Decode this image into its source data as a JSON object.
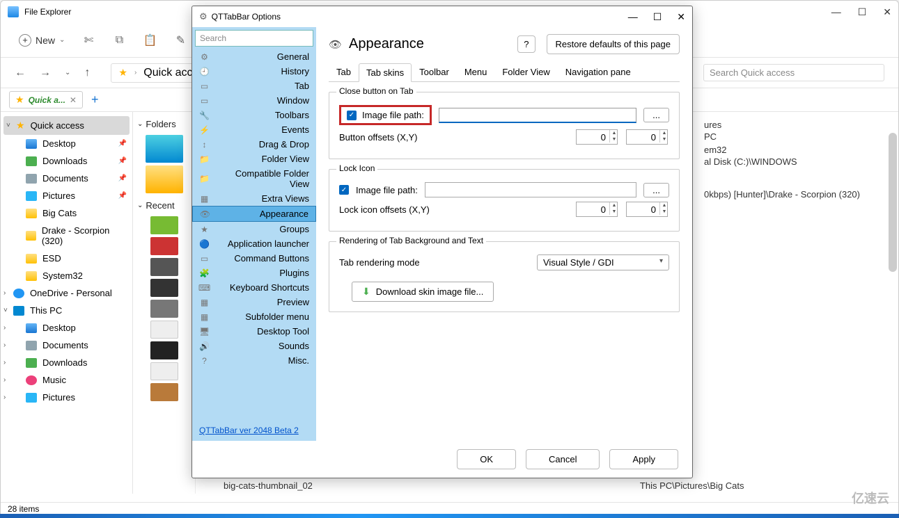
{
  "explorer": {
    "title": "File Explorer",
    "new_label": "New",
    "nav_path": "Quick access",
    "search_placeholder": "Search Quick access",
    "tab_label": "Quick a...",
    "status": "28 items",
    "sidebar": [
      {
        "label": "Quick access",
        "icon": "star",
        "selected": true,
        "caret": "˅"
      },
      {
        "label": "Desktop",
        "icon": "blue",
        "pin": true,
        "indent": true
      },
      {
        "label": "Downloads",
        "icon": "green",
        "pin": true,
        "indent": true
      },
      {
        "label": "Documents",
        "icon": "doc",
        "pin": true,
        "indent": true
      },
      {
        "label": "Pictures",
        "icon": "pic",
        "pin": true,
        "indent": true
      },
      {
        "label": "Big Cats",
        "icon": "folder",
        "indent": true
      },
      {
        "label": "Drake - Scorpion (320)",
        "icon": "folder",
        "indent": true
      },
      {
        "label": "ESD",
        "icon": "folder",
        "indent": true
      },
      {
        "label": "System32",
        "icon": "folder",
        "indent": true
      },
      {
        "label": "OneDrive - Personal",
        "icon": "cloud",
        "caret": "›"
      },
      {
        "label": "This PC",
        "icon": "pc",
        "caret": "˅"
      },
      {
        "label": "Desktop",
        "icon": "blue",
        "indent": true,
        "caret": "›"
      },
      {
        "label": "Documents",
        "icon": "doc",
        "indent": true,
        "caret": "›"
      },
      {
        "label": "Downloads",
        "icon": "green",
        "indent": true,
        "caret": "›"
      },
      {
        "label": "Music",
        "icon": "music",
        "indent": true,
        "caret": "›"
      },
      {
        "label": "Pictures",
        "icon": "pic",
        "indent": true,
        "caret": "›"
      }
    ],
    "middle": {
      "folders_label": "Folders",
      "recent_label": "Recent"
    },
    "right_lines": [
      "ures",
      "PC",
      "",
      "em32",
      "al Disk (C:)\\WINDOWS",
      "",
      "",
      "",
      "",
      "",
      "",
      "",
      "",
      "",
      "",
      "",
      "",
      "",
      "",
      "",
      "0kbps) [Hunter]\\Drake - Scorpion (320)"
    ],
    "file_row_name": "big-cats-thumbnail_02",
    "file_row_loc": "This PC\\Pictures\\Big Cats"
  },
  "dialog": {
    "title": "QTTabBar Options",
    "search_placeholder": "Search",
    "header": "Appearance",
    "help_tooltip": "?",
    "restore_label": "Restore defaults of this page",
    "version": "QTTabBar ver 2048 Beta 2",
    "categories": [
      "General",
      "History",
      "Tab",
      "Window",
      "Toolbars",
      "Events",
      "Drag & Drop",
      "Folder View",
      "Compatible Folder View",
      "Extra Views",
      "Appearance",
      "Groups",
      "Application launcher",
      "Command Buttons",
      "Plugins",
      "Keyboard Shortcuts",
      "Preview",
      "Subfolder menu",
      "Desktop Tool",
      "Sounds",
      "Misc."
    ],
    "category_selected": "Appearance",
    "sub_tabs": [
      "Tab",
      "Tab skins",
      "Toolbar",
      "Menu",
      "Folder View",
      "Navigation pane"
    ],
    "sub_tab_active": "Tab skins",
    "group1": {
      "legend": "Close button on Tab",
      "check_label": "Image file path:",
      "browse": "...",
      "offsets_label": "Button offsets (X,Y)",
      "x": "0",
      "y": "0"
    },
    "group2": {
      "legend": "Lock Icon",
      "check_label": "Image file path:",
      "browse": "...",
      "offsets_label": "Lock icon offsets (X,Y)",
      "x": "0",
      "y": "0"
    },
    "group3": {
      "legend": "Rendering of Tab Background and Text",
      "mode_label": "Tab rendering mode",
      "mode_value": "Visual Style / GDI",
      "download_label": "Download skin image file..."
    },
    "buttons": {
      "ok": "OK",
      "cancel": "Cancel",
      "apply": "Apply"
    }
  },
  "watermark": "亿速云"
}
